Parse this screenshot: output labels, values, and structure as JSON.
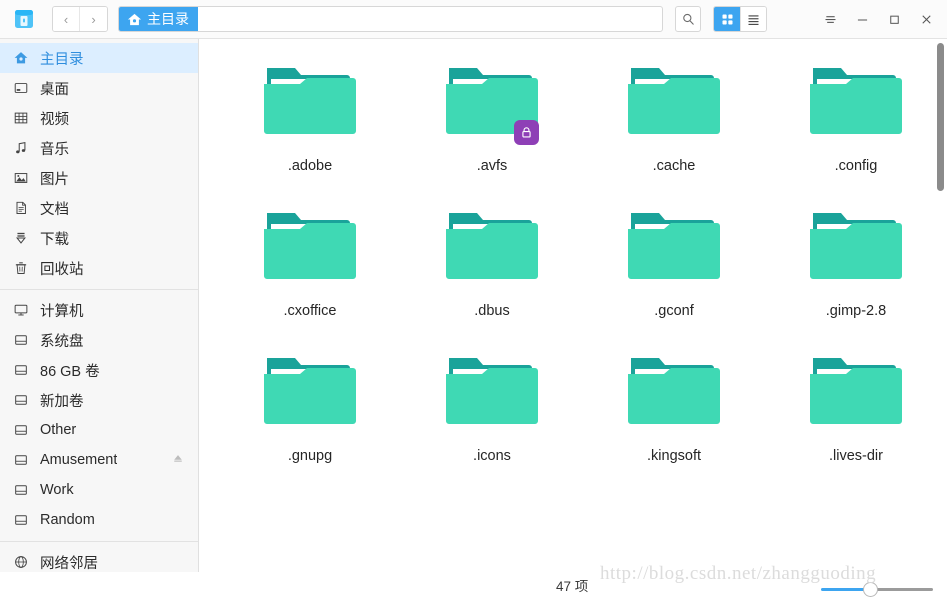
{
  "window": {
    "app_icon": "file-manager-icon",
    "controls": {
      "menu": "☰",
      "minimize": "—",
      "maximize": "□",
      "close": "✕"
    }
  },
  "toolbar": {
    "back_label": "‹",
    "forward_label": "›",
    "breadcrumb": "主目录",
    "search_icon": "search-icon",
    "grid_view_icon": "grid-view-icon",
    "list_view_icon": "list-view-icon",
    "active_view": "grid",
    "accent_color": "#3da5f0"
  },
  "sidebar": {
    "groups": [
      {
        "items": [
          {
            "label": "主目录",
            "icon": "home-icon",
            "selected": true
          },
          {
            "label": "桌面",
            "icon": "desktop-icon",
            "selected": false
          },
          {
            "label": "视频",
            "icon": "video-icon",
            "selected": false
          },
          {
            "label": "音乐",
            "icon": "music-icon",
            "selected": false
          },
          {
            "label": "图片",
            "icon": "picture-icon",
            "selected": false
          },
          {
            "label": "文档",
            "icon": "document-icon",
            "selected": false
          },
          {
            "label": "下载",
            "icon": "download-icon",
            "selected": false
          },
          {
            "label": "回收站",
            "icon": "trash-icon",
            "selected": false
          }
        ]
      },
      {
        "items": [
          {
            "label": "计算机",
            "icon": "computer-icon",
            "selected": false
          },
          {
            "label": "系统盘",
            "icon": "drive-icon",
            "selected": false
          },
          {
            "label": "86 GB 卷",
            "icon": "drive-icon",
            "selected": false
          },
          {
            "label": "新加卷",
            "icon": "drive-icon",
            "selected": false
          },
          {
            "label": "Other",
            "icon": "drive-icon",
            "selected": false
          },
          {
            "label": "Amusement",
            "icon": "drive-icon",
            "selected": false,
            "eject": true
          },
          {
            "label": "Work",
            "icon": "drive-icon",
            "selected": false
          },
          {
            "label": "Random",
            "icon": "drive-icon",
            "selected": false
          }
        ]
      },
      {
        "items": [
          {
            "label": "网络邻居",
            "icon": "network-icon",
            "selected": false
          }
        ]
      }
    ]
  },
  "main": {
    "folder_color_back": "#1aa39a",
    "folder_color_front": "#3fd9b4",
    "lock_badge_color": "#8e3fb6",
    "items": [
      {
        "name": ".adobe",
        "type": "folder",
        "locked": false
      },
      {
        "name": ".avfs",
        "type": "folder",
        "locked": true
      },
      {
        "name": ".cache",
        "type": "folder",
        "locked": false
      },
      {
        "name": ".config",
        "type": "folder",
        "locked": false
      },
      {
        "name": ".cxoffice",
        "type": "folder",
        "locked": false
      },
      {
        "name": ".dbus",
        "type": "folder",
        "locked": false
      },
      {
        "name": ".gconf",
        "type": "folder",
        "locked": false
      },
      {
        "name": ".gimp-2.8",
        "type": "folder",
        "locked": false
      },
      {
        "name": ".gnupg",
        "type": "folder",
        "locked": false
      },
      {
        "name": ".icons",
        "type": "folder",
        "locked": false
      },
      {
        "name": ".kingsoft",
        "type": "folder",
        "locked": false
      },
      {
        "name": ".lives-dir",
        "type": "folder",
        "locked": false
      }
    ]
  },
  "statusbar": {
    "item_count": "47 项",
    "zoom_value": 38
  },
  "watermark": {
    "text": "http://blog.csdn.net/zhangguoding"
  }
}
